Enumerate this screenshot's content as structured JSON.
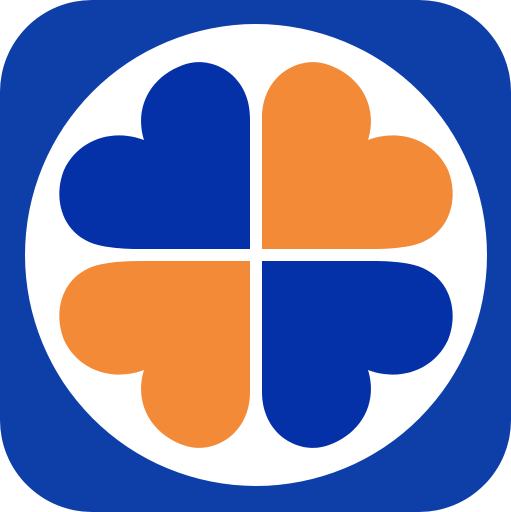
{
  "icon": {
    "name": "four-leaf-clover-logo",
    "colors": {
      "frame": "#0e3fa9",
      "circle": "#ffffff",
      "blue_leaf": "#0430a8",
      "orange_leaf": "#f28a38"
    },
    "leaves": [
      {
        "position": "top-left",
        "color": "blue"
      },
      {
        "position": "top-right",
        "color": "orange"
      },
      {
        "position": "bottom-left",
        "color": "orange"
      },
      {
        "position": "bottom-right",
        "color": "blue"
      }
    ]
  }
}
